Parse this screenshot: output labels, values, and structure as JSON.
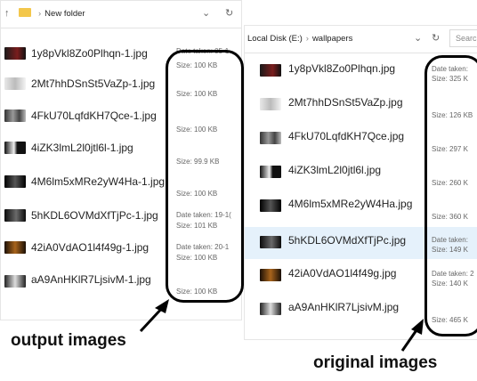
{
  "left_window": {
    "path": "New folder",
    "files": [
      {
        "name": "1y8pVkl8Zo0Plhqn-1.jpg",
        "date": "Date taken: 05-1",
        "size": "Size: 100 KB"
      },
      {
        "name": "2Mt7hhDSnSt5VaZp-1.jpg",
        "date": "",
        "size": "Size: 100 KB"
      },
      {
        "name": "4FkU70LqfdKH7Qce-1.jpg",
        "date": "",
        "size": "Size: 100 KB"
      },
      {
        "name": "4iZK3lmL2l0jtl6l-1.jpg",
        "date": "",
        "size": "Size: 99.9 KB"
      },
      {
        "name": "4M6lm5xMRe2yW4Ha-1.jpg",
        "date": "",
        "size": "Size: 100 KB"
      },
      {
        "name": "5hKDL6OVMdXfTjPc-1.jpg",
        "date": "Date taken: 19-1(",
        "size": "Size: 101 KB"
      },
      {
        "name": "42iA0VdAO1l4f49g-1.jpg",
        "date": "Date taken: 20-1",
        "size": "Size: 100 KB"
      },
      {
        "name": "aA9AnHKlR7LjsivM-1.jpg",
        "date": "",
        "size": "Size: 100 KB"
      }
    ]
  },
  "right_window": {
    "drive": "Local Disk (E:)",
    "path": "wallpapers",
    "search_placeholder": "Searc",
    "files": [
      {
        "name": "1y8pVkl8Zo0Plhqn.jpg",
        "date": "Date taken:",
        "size": "Size: 325 K"
      },
      {
        "name": "2Mt7hhDSnSt5VaZp.jpg",
        "date": "",
        "size": "Size: 126 KB"
      },
      {
        "name": "4FkU70LqfdKH7Qce.jpg",
        "date": "",
        "size": "Size: 297 K"
      },
      {
        "name": "4iZK3lmL2l0jtl6l.jpg",
        "date": "",
        "size": "Size: 260 K"
      },
      {
        "name": "4M6lm5xMRe2yW4Ha.jpg",
        "date": "",
        "size": "Size: 360 K"
      },
      {
        "name": "5hKDL6OVMdXfTjPc.jpg",
        "date": "Date taken:",
        "size": "Size: 149 K"
      },
      {
        "name": "42iA0VdAO1l4f49g.jpg",
        "date": "Date taken: 2",
        "size": "Size: 140 K"
      },
      {
        "name": "aA9AnHKlR7LjsivM.jpg",
        "date": "",
        "size": "Size: 465 K"
      }
    ]
  },
  "annotations": {
    "left_label": "output images",
    "right_label": "original images"
  },
  "icons": {
    "nav_up": "arrow-up-icon",
    "folder": "folder-icon",
    "dropdown": "chevron-down-icon",
    "refresh": "refresh-icon"
  },
  "colors": {
    "selected_row": "#e5f1fb",
    "folder": "#f3c74b",
    "annotation": "#000000"
  }
}
